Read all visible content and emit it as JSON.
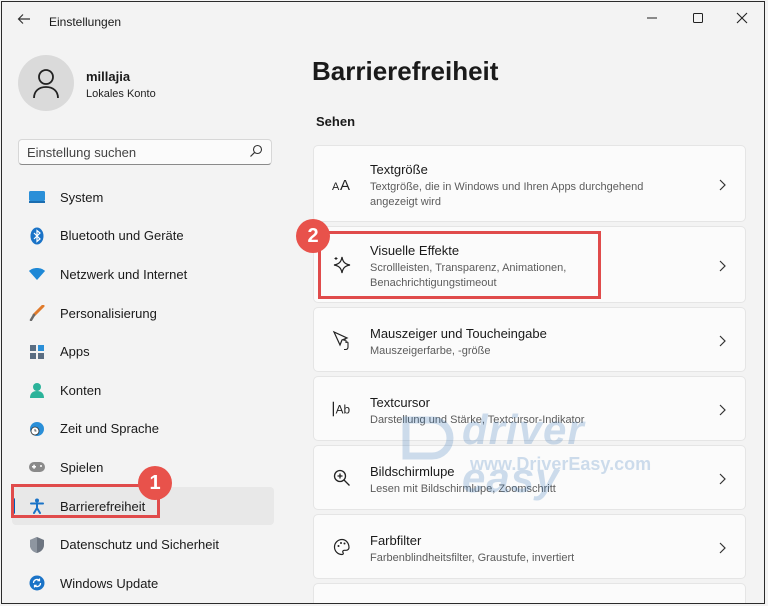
{
  "window": {
    "title": "Einstellungen"
  },
  "user": {
    "name": "millajia",
    "account": "Lokales Konto"
  },
  "search": {
    "placeholder": "Einstellung suchen"
  },
  "sidebar": {
    "items": [
      {
        "label": "System",
        "icon": "system-icon"
      },
      {
        "label": "Bluetooth und Geräte",
        "icon": "bluetooth-icon"
      },
      {
        "label": "Netzwerk und Internet",
        "icon": "wifi-icon"
      },
      {
        "label": "Personalisierung",
        "icon": "brush-icon"
      },
      {
        "label": "Apps",
        "icon": "apps-icon"
      },
      {
        "label": "Konten",
        "icon": "account-icon"
      },
      {
        "label": "Zeit und Sprache",
        "icon": "globe-clock-icon"
      },
      {
        "label": "Spielen",
        "icon": "gamepad-icon"
      },
      {
        "label": "Barrierefreiheit",
        "icon": "accessibility-icon",
        "selected": true
      },
      {
        "label": "Datenschutz und Sicherheit",
        "icon": "shield-icon"
      },
      {
        "label": "Windows Update",
        "icon": "update-icon"
      }
    ]
  },
  "main": {
    "title": "Barrierefreiheit",
    "section": "Sehen",
    "cards": [
      {
        "title": "Textgröße",
        "desc": "Textgröße, die in Windows und Ihren Apps durchgehend angezeigt wird",
        "icon": "text-size-icon"
      },
      {
        "title": "Visuelle Effekte",
        "desc": "Scrollleisten, Transparenz, Animationen, Benachrichtigungstimeout",
        "icon": "sparkle-icon"
      },
      {
        "title": "Mauszeiger und Toucheingabe",
        "desc": "Mauszeigerfarbe, -größe",
        "icon": "pointer-icon"
      },
      {
        "title": "Textcursor",
        "desc": "Darstellung und Stärke, Textcursor-Indikator",
        "icon": "text-cursor-icon"
      },
      {
        "title": "Bildschirmlupe",
        "desc": "Lesen mit Bildschirmlupe, Zoomschritt",
        "icon": "magnifier-icon"
      },
      {
        "title": "Farbfilter",
        "desc": "Farbenblindheitsfilter, Graustufe, invertiert",
        "icon": "palette-icon"
      }
    ]
  },
  "annotations": {
    "badge1": "1",
    "badge2": "2"
  },
  "watermark": {
    "line1": "driver easy",
    "line2": "www.DriverEasy.com"
  },
  "colors": {
    "accent": "#005fb8",
    "highlight": "#e04b4b"
  }
}
